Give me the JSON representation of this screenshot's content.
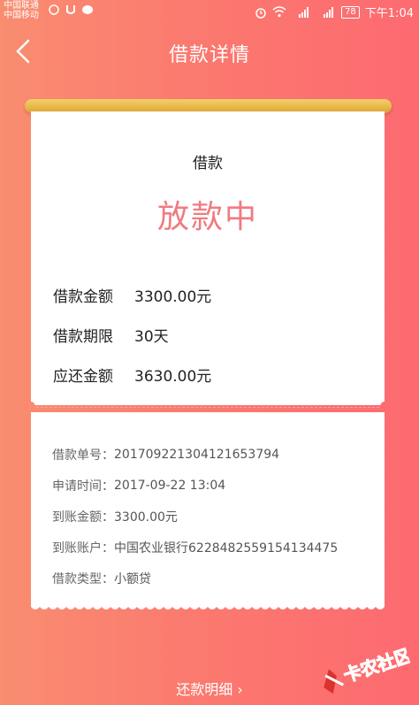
{
  "status_bar": {
    "carrier_1": "中国联通",
    "carrier_2": "中国移动",
    "battery": "78",
    "time": "下午1:04"
  },
  "header": {
    "title": "借款详情"
  },
  "loan": {
    "type_label": "借款",
    "status": "放款中",
    "summary": [
      {
        "label": "借款金额",
        "value": "3300.00元"
      },
      {
        "label": "借款期限",
        "value": "30天"
      },
      {
        "label": "应还金额",
        "value": "3630.00元"
      }
    ],
    "details": [
      {
        "label": "借款单号：",
        "value": "20170922130412165379​4"
      },
      {
        "label": "申请时间：",
        "value": "2017-09-22 13:04"
      },
      {
        "label": "到账金额：",
        "value": "3300.00元"
      },
      {
        "label": "到账账户：",
        "value": "中国农业银行6228482559154134475"
      },
      {
        "label": "借款类型：",
        "value": "小额贷"
      }
    ]
  },
  "footer": {
    "repay_link": "还款明细 ›"
  },
  "watermark": {
    "text": "卡农社区"
  },
  "colors": {
    "accent": "#f07b81",
    "scroll": "#e9b848"
  }
}
